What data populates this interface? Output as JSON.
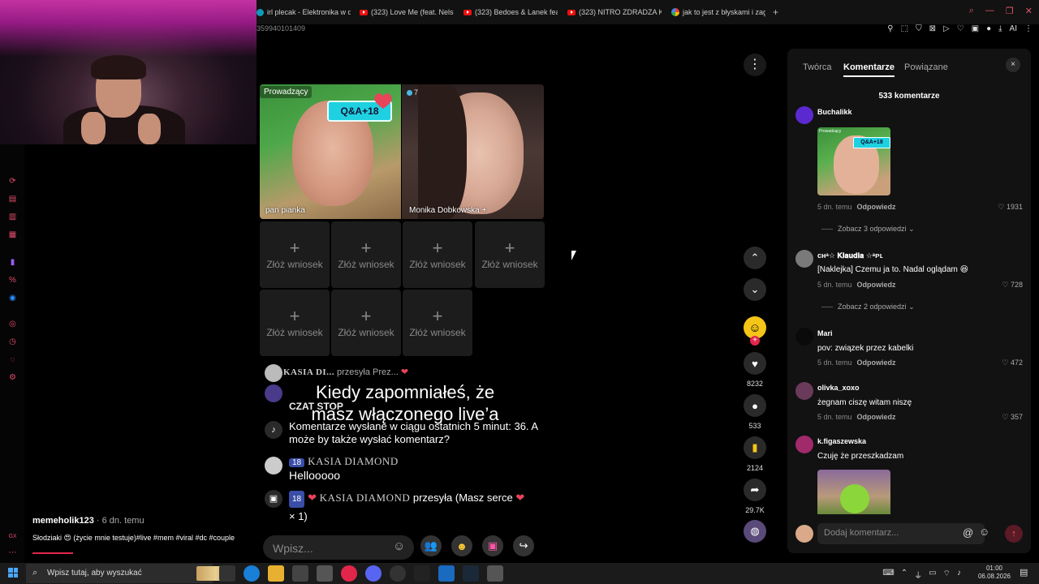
{
  "browser": {
    "tabs": [
      {
        "label": "irl plecak - Elektronika w d",
        "icon": "generic"
      },
      {
        "label": "(323) Love Me (feat. Nelso",
        "icon": "youtube"
      },
      {
        "label": "(323) Bedoes & Lanek feat.",
        "icon": "youtube"
      },
      {
        "label": "(323) NITRO ZDRADZA KO",
        "icon": "youtube"
      },
      {
        "label": "jak to jest z błyskami i zagr",
        "icon": "google"
      }
    ],
    "new_tab": "+",
    "address_fragment": "359940101409",
    "toolbar_ai": "AI"
  },
  "stream": {
    "host_prefix": "Prowadzący",
    "host_name": "pan pianka",
    "qa_badge": "Q&A+18",
    "guest_name": "Monika Dobkowska",
    "guest_plus": "+",
    "guest_count": "7",
    "slot_plus": "+",
    "slot_label": "Złóż wniosek",
    "slots": 7
  },
  "chat": {
    "gift_line_user": "KASIA DI...",
    "gift_line_text": "przesyła Prez...",
    "caption": "Kiedy zapomniałeś, że masz włączonego live’a",
    "czat_stop": "CZAT STOP",
    "system_msg": "Komentarze wysłane w ciągu ostatnich 5 minut: 36. A może by także wysłać komentarz?",
    "msg1_badge": "18",
    "msg1_user": "KASIA DIAMOND",
    "msg1_text": "Hellooooo",
    "msg2_badge": "18",
    "msg2_user": "KASIA DIAMOND",
    "msg2_text": "przesyła (Masz serce",
    "msg2_suffix": "× 1)",
    "input_placeholder": "Wpisz..."
  },
  "rail": {
    "likes": "8232",
    "comments": "533",
    "saves": "2124",
    "shares": "29.7K"
  },
  "panel": {
    "tabs": [
      "Twórca",
      "Komentarze",
      "Powiązane"
    ],
    "active_tab": "Komentarze",
    "close": "×",
    "count": "533 komentarze",
    "reply_label": "Odpowiedz",
    "comments": [
      {
        "user": "Buchalikk",
        "text": "",
        "time": "5 dn. temu",
        "likes": "1931",
        "more": "Zobacz 3 odpowiedzi",
        "avatar_color": "#5a2ad0"
      },
      {
        "user": "ᴄʜᵃ☆ 𝐊𝐥𝐚𝐮𝐝𝐢𝐚 ☆ᵃᴘʟ",
        "text": "[Naklejka] Czemu ja to. Nadal oglądam 😆",
        "time": "5 dn. temu",
        "likes": "728",
        "more": "Zobacz 2 odpowiedzi",
        "avatar_color": "#7a7a7a"
      },
      {
        "user": "Mari",
        "text": "pov: związek przez kabelki",
        "time": "5 dn. temu",
        "likes": "472",
        "more": "",
        "avatar_color": "#0a0a0a"
      },
      {
        "user": "olivka_xoxo",
        "text": "żegnam ciszę witam niszę",
        "time": "5 dn. temu",
        "likes": "357",
        "more": "",
        "avatar_color": "#6a3a5a"
      },
      {
        "user": "k.figaszewska",
        "text": "Czuję że przeszkadzam",
        "time": "",
        "likes": "",
        "more": "",
        "avatar_color": "#a02a6a"
      }
    ],
    "sticker_host_label": "Prowadzący",
    "sticker_qa": "Q&A+18",
    "composer_placeholder": "Dodaj komentarz..."
  },
  "description": {
    "user": "memeholik123",
    "ago": "· 6 dn. temu",
    "text": "Słodziaki 😍 (życie mnie testuje)#live #mem #viral #dc #couple"
  },
  "taskbar": {
    "search_placeholder": "Wpisz tutaj, aby wyszukać",
    "time": "01:00",
    "date": "06.08.2026"
  },
  "colors": {
    "accent": "#e2264b",
    "qa_badge": "#1fd1e0",
    "panel_bg": "#121212"
  }
}
